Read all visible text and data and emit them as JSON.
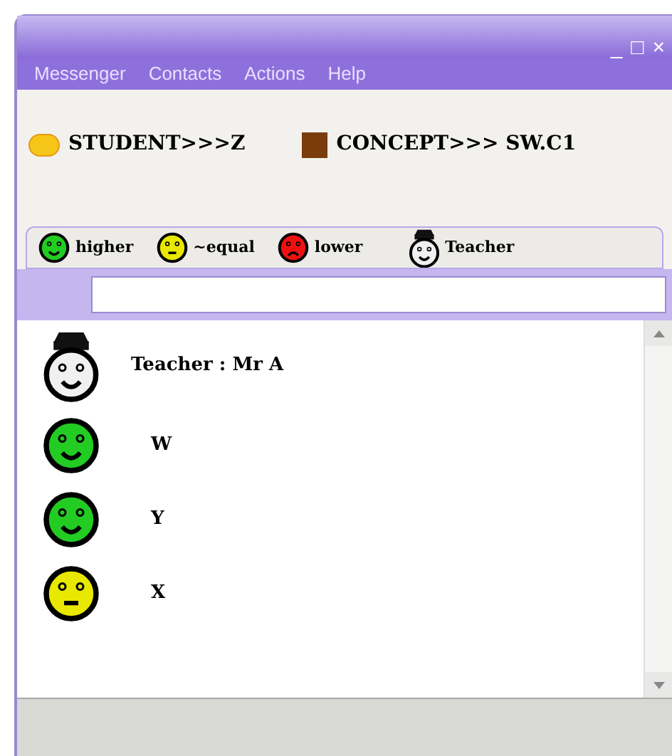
{
  "window": {
    "controls": [
      "_",
      "□",
      "×"
    ]
  },
  "menu": [
    "Messenger",
    "Contacts",
    "Actions",
    "Help"
  ],
  "info": [
    {
      "kind": "sun",
      "label": "STUDENT>>>Z"
    },
    {
      "kind": "square",
      "label": "CONCEPT>>> SW.C1"
    }
  ],
  "legend": [
    {
      "kind": "happy",
      "label": "higher"
    },
    {
      "kind": "neutral",
      "label": "~equal"
    },
    {
      "kind": "sad",
      "label": "lower"
    },
    {
      "kind": "teacher",
      "label": "Teacher"
    }
  ],
  "contacts": [
    {
      "kind": "teacher",
      "name": "Teacher : Mr A"
    },
    {
      "kind": "happy",
      "name": "W"
    },
    {
      "kind": "happy",
      "name": "Y"
    },
    {
      "kind": "neutral",
      "name": "X"
    }
  ]
}
